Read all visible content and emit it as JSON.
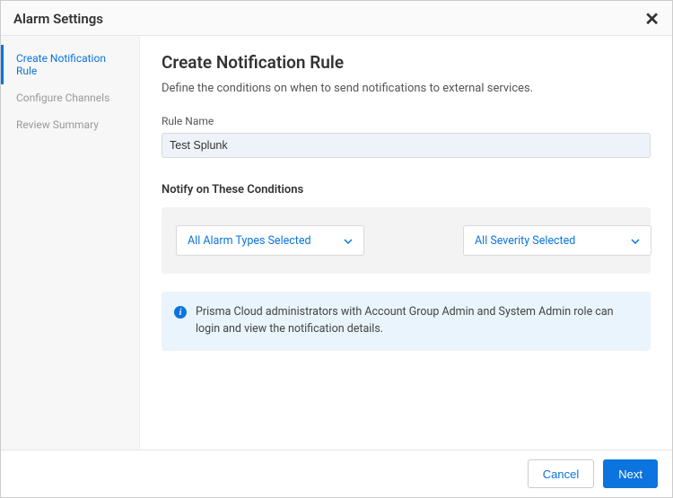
{
  "titlebar": {
    "title": "Alarm Settings"
  },
  "sidebar": {
    "steps": [
      {
        "label": "Create Notification Rule",
        "active": true
      },
      {
        "label": "Configure Channels",
        "active": false
      },
      {
        "label": "Review Summary",
        "active": false
      }
    ]
  },
  "main": {
    "heading": "Create Notification Rule",
    "subtitle": "Define the conditions on when to send notifications to external services.",
    "rule_name_label": "Rule Name",
    "rule_name_value": "Test Splunk",
    "conditions_label": "Notify on These Conditions",
    "alarm_types_selected": "All Alarm Types Selected",
    "severity_selected": "All Severity Selected",
    "info_text": "Prisma Cloud administrators with Account Group Admin and System Admin role can login and view the notification details."
  },
  "footer": {
    "cancel": "Cancel",
    "next": "Next"
  }
}
